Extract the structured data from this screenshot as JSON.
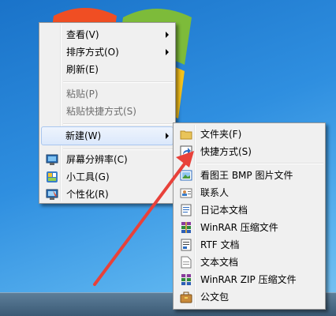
{
  "context_menu": {
    "items": [
      {
        "label": "查看(V)",
        "submenu": true,
        "disabled": false
      },
      {
        "label": "排序方式(O)",
        "submenu": true,
        "disabled": false
      },
      {
        "label": "刷新(E)",
        "submenu": false,
        "disabled": false
      },
      {
        "label": "粘贴(P)",
        "submenu": false,
        "disabled": true
      },
      {
        "label": "粘贴快捷方式(S)",
        "submenu": false,
        "disabled": true
      },
      {
        "label": "新建(W)",
        "submenu": true,
        "disabled": false,
        "highlighted": true
      },
      {
        "label": "屏幕分辨率(C)",
        "icon": "monitor-icon"
      },
      {
        "label": "小工具(G)",
        "icon": "gadgets-icon"
      },
      {
        "label": "个性化(R)",
        "icon": "personalize-icon"
      }
    ]
  },
  "new_submenu": {
    "items": [
      {
        "label": "文件夹(F)",
        "icon": "folder-icon"
      },
      {
        "label": "快捷方式(S)",
        "icon": "shortcut-icon"
      },
      {
        "label": "看图王 BMP 图片文件",
        "icon": "image-file-icon"
      },
      {
        "label": "联系人",
        "icon": "contact-icon"
      },
      {
        "label": "日记本文档",
        "icon": "journal-icon"
      },
      {
        "label": "WinRAR 压缩文件",
        "icon": "winrar-icon"
      },
      {
        "label": "RTF 文档",
        "icon": "rtf-icon"
      },
      {
        "label": "文本文档",
        "icon": "text-file-icon"
      },
      {
        "label": "WinRAR ZIP 压缩文件",
        "icon": "winrar-zip-icon"
      },
      {
        "label": "公文包",
        "icon": "briefcase-icon"
      }
    ]
  },
  "colors": {
    "annotation_arrow": "#e8413a",
    "menu_bg": "#f0f0f0",
    "highlight_border": "#a9c6ef"
  }
}
